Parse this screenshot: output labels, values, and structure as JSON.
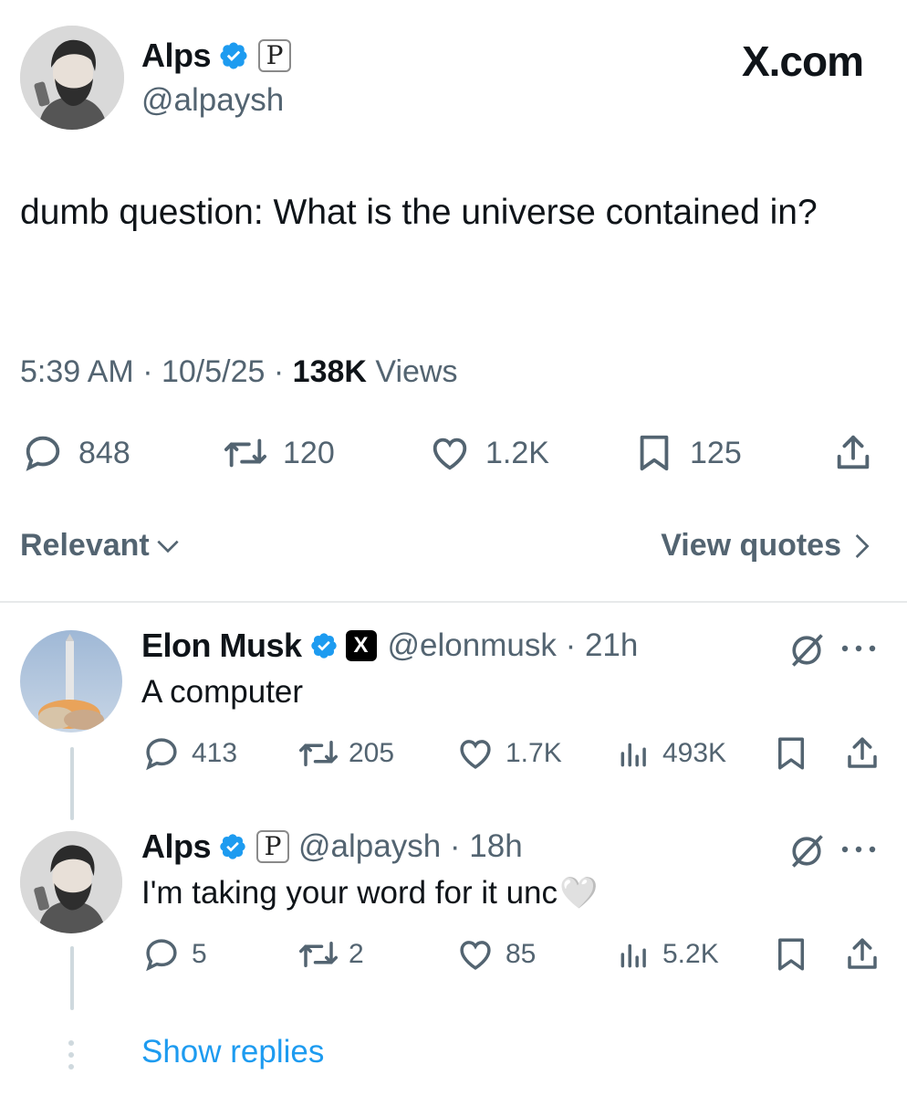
{
  "brand": "X.com",
  "post": {
    "author_name": "Alps",
    "author_handle": "@alpaysh",
    "badge_letter": "P",
    "text": "dumb question: What is the universe contained in?",
    "time": "5:39 AM",
    "date": "10/5/25",
    "views_count": "138K",
    "views_label": "Views",
    "replies": "848",
    "reposts": "120",
    "likes": "1.2K",
    "bookmarks": "125"
  },
  "sort": {
    "label": "Relevant"
  },
  "view_quotes": {
    "label": "View quotes"
  },
  "replies": [
    {
      "author_name": "Elon Musk",
      "author_handle": "@elonmusk",
      "affiliation_badge": "X",
      "time": "21h",
      "text": "A computer",
      "replies": "413",
      "reposts": "205",
      "likes": "1.7K",
      "views": "493K"
    },
    {
      "author_name": "Alps",
      "author_handle": "@alpaysh",
      "affiliation_badge": "P",
      "time": "18h",
      "text": "I'm taking your word for it unc",
      "emoji": "🤍",
      "replies": "5",
      "reposts": "2",
      "likes": "85",
      "views": "5.2K"
    }
  ],
  "show_replies": "Show replies",
  "colors": {
    "text_primary": "#0f1419",
    "text_secondary": "#536471",
    "link_blue": "#1d9bf0",
    "verified_blue": "#1d9bf0",
    "divider": "#e7e9ea"
  }
}
